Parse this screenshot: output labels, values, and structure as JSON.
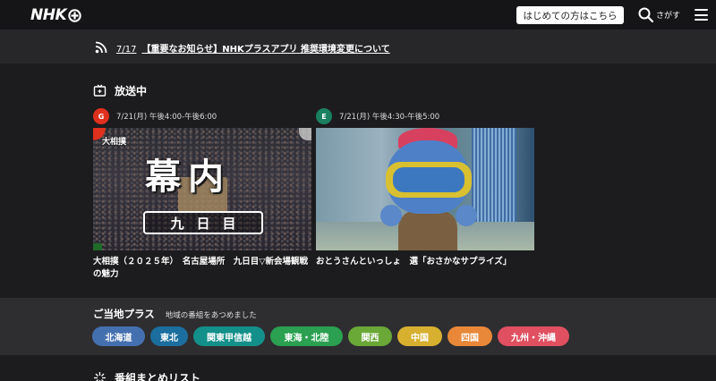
{
  "header": {
    "logo": "NHK",
    "first_time_label": "はじめての方はこちら",
    "search_label": "さがす",
    "icons": {
      "plus": "plus-icon",
      "search": "search-icon",
      "menu": "menu-icon"
    }
  },
  "notice": {
    "icon": "rss-icon",
    "date": "7/17",
    "text": "【重要なお知らせ】NHKプラスアプリ 推奨環境変更について"
  },
  "on_air": {
    "title": "放送中",
    "icon": "tv-icon",
    "programs": [
      {
        "channel": "G",
        "channel_color": "#e0301e",
        "time": "7/21(月) 午後4:00-午後6:00",
        "thumb_kicker": "大相撲",
        "thumb_title": "幕内",
        "thumb_day": "九日目",
        "title": "大相撲（２０２５年）　名古屋場所　九日目▽新会場観戦の魅力"
      },
      {
        "channel": "E",
        "channel_color": "#1a8060",
        "time": "7/21(月) 午後4:30-午後5:00",
        "title": "おとうさんといっしょ　選「おさかなサプライズ」"
      }
    ]
  },
  "local": {
    "title": "ご当地プラス",
    "subtitle": "地域の番組をあつめました",
    "regions": [
      {
        "label": "北海道",
        "color": "#4570b0"
      },
      {
        "label": "東北",
        "color": "#1b6e9e"
      },
      {
        "label": "関東甲信越",
        "color": "#14908a"
      },
      {
        "label": "東海・北陸",
        "color": "#2aa050"
      },
      {
        "label": "関西",
        "color": "#6aa838"
      },
      {
        "label": "中国",
        "color": "#d8b030"
      },
      {
        "label": "四国",
        "color": "#e88838"
      },
      {
        "label": "九州・沖縄",
        "color": "#e05060"
      }
    ]
  },
  "list_section": {
    "title": "番組まとめリスト",
    "icon": "sparkle-icon"
  }
}
